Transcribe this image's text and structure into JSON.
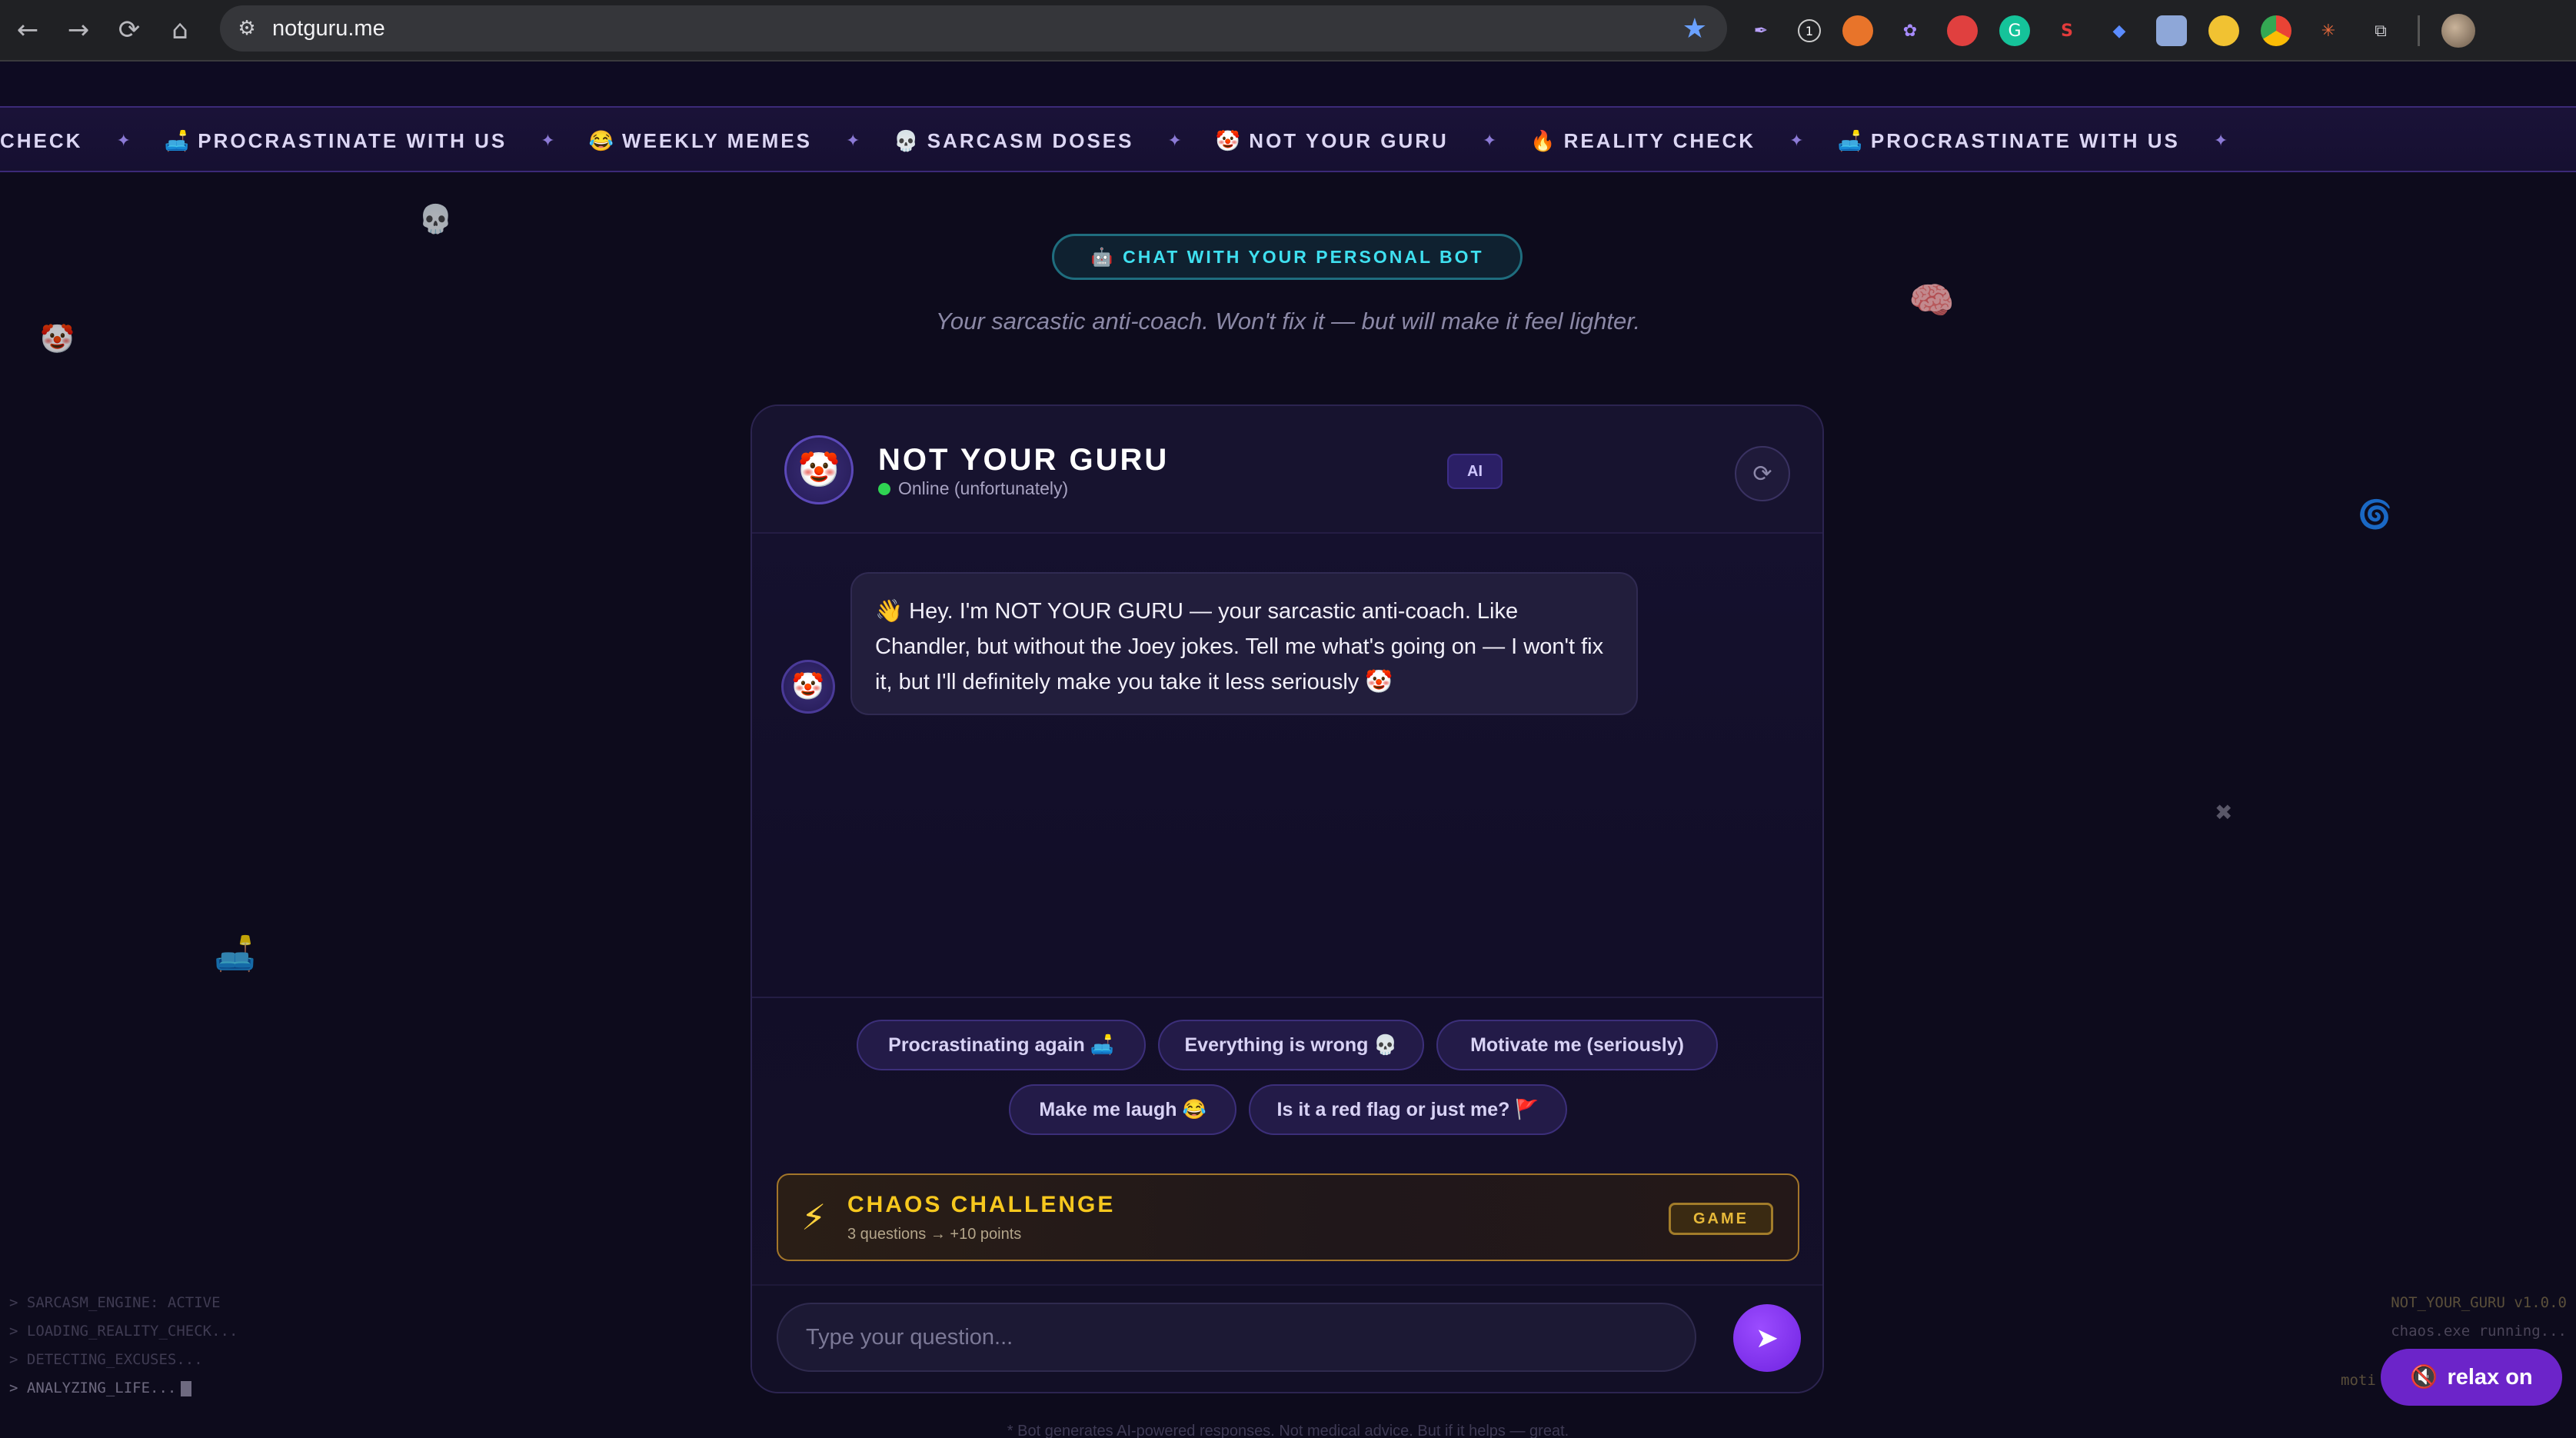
{
  "browser": {
    "url": "notguru.me",
    "nav": {
      "back": "←",
      "forward": "→",
      "reload": "⟳",
      "home": "⌂"
    },
    "extensions": [
      "feather-icon",
      "badge-1-icon",
      "orange-circle-icon",
      "flower-icon",
      "red-drop-icon",
      "grammarly-icon",
      "s-icon",
      "tag-icon",
      "screen-icon",
      "duck-icon",
      "chrome-icon",
      "asterisk-icon",
      "puzzle-icon"
    ],
    "ext_badge": "1"
  },
  "marquee": {
    "items": [
      {
        "emoji": "",
        "label": "CHECK"
      },
      {
        "emoji": "🛋️",
        "label": "PROCRASTINATE WITH US"
      },
      {
        "emoji": "😂",
        "label": "WEEKLY MEMES"
      },
      {
        "emoji": "💀",
        "label": "SARCASM DOSES"
      },
      {
        "emoji": "🤡",
        "label": "NOT YOUR GURU"
      },
      {
        "emoji": "🔥",
        "label": "REALITY CHECK"
      },
      {
        "emoji": "🛋️",
        "label": "PROCRASTINATE WITH US"
      }
    ],
    "separator": "✦"
  },
  "hero": {
    "pill_icon": "🤖",
    "pill_label": "CHAT WITH YOUR PERSONAL BOT",
    "subtitle": "Your sarcastic anti-coach. Won't fix it — but will make it feel lighter."
  },
  "chat": {
    "bot_avatar": "🤡",
    "bot_name": "NOT YOUR GURU",
    "status": "Online (unfortunately)",
    "ai_badge": "AI",
    "refresh_icon": "⟳",
    "message": "👋 Hey. I'm NOT YOUR GURU — your sarcastic anti-coach. Like Chandler, but without the Joey jokes. Tell me what's going on — I won't fix it, but I'll definitely make you take it less seriously 🤡",
    "chips": [
      "Procrastinating again 🛋️",
      "Everything is wrong 💀",
      "Motivate me (seriously)",
      "Make me laugh 😂",
      "Is it a red flag or just me? 🚩"
    ],
    "challenge": {
      "icon": "⚡",
      "title": "CHAOS CHALLENGE",
      "subtitle": "3 questions → +10 points",
      "badge": "GAME"
    },
    "input_placeholder": "Type your question...",
    "send_icon": "➤"
  },
  "terminal_left": [
    "> SARCASM_ENGINE: ACTIVE",
    "> LOADING_REALITY_CHECK...",
    "> DETECTING_EXCUSES...",
    "> ANALYZING_LIFE..."
  ],
  "terminal_right": [
    "NOT_YOUR_GURU v1.0.0",
    "chaos.exe running..."
  ],
  "terminal_right_partial": "moti",
  "relax_button": {
    "icon": "🔇",
    "label": "relax on"
  },
  "footer_note": "* Bot generates AI-powered responses. Not medical advice. But if it helps — great.",
  "floating_emojis": [
    "💀",
    "🤡",
    "🧠",
    "🌀",
    "🛋️",
    "✖"
  ]
}
